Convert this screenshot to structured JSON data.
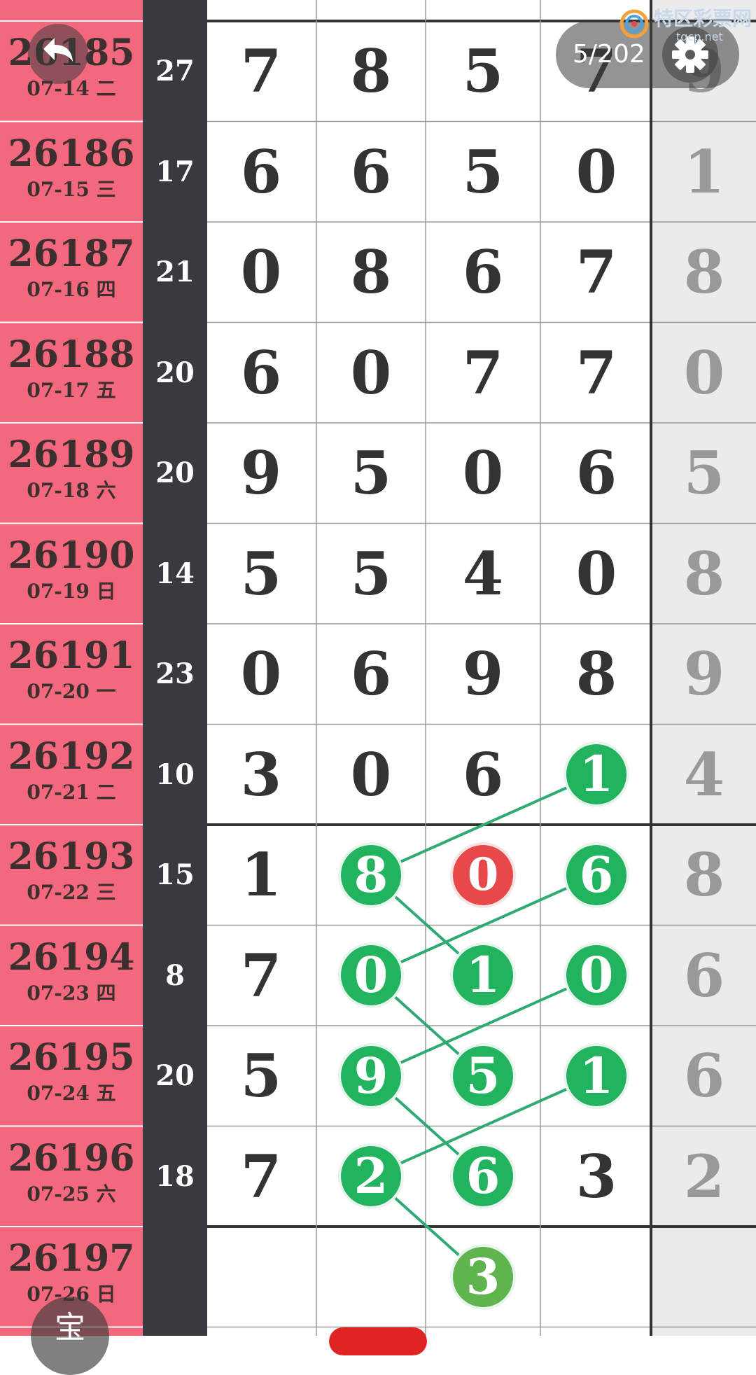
{
  "header": {
    "back_icon": "back-arrow-icon",
    "page_indicator": "5/202",
    "settings_icon": "gear-icon",
    "brand_name": "特区彩票网",
    "brand_url": "tqcp.net"
  },
  "rows": [
    {
      "issue": "26185",
      "date": "07-14 二",
      "sum": "27",
      "d": [
        "7",
        "8",
        "5",
        "7"
      ],
      "last": "9"
    },
    {
      "issue": "26186",
      "date": "07-15 三",
      "sum": "17",
      "d": [
        "6",
        "6",
        "5",
        "0"
      ],
      "last": "1"
    },
    {
      "issue": "26187",
      "date": "07-16 四",
      "sum": "21",
      "d": [
        "0",
        "8",
        "6",
        "7"
      ],
      "last": "8"
    },
    {
      "issue": "26188",
      "date": "07-17 五",
      "sum": "20",
      "d": [
        "6",
        "0",
        "7",
        "7"
      ],
      "last": "0"
    },
    {
      "issue": "26189",
      "date": "07-18 六",
      "sum": "20",
      "d": [
        "9",
        "5",
        "0",
        "6"
      ],
      "last": "5"
    },
    {
      "issue": "26190",
      "date": "07-19 日",
      "sum": "14",
      "d": [
        "5",
        "5",
        "4",
        "0"
      ],
      "last": "8"
    },
    {
      "issue": "26191",
      "date": "07-20 一",
      "sum": "23",
      "d": [
        "0",
        "6",
        "9",
        "8"
      ],
      "last": "9"
    },
    {
      "issue": "26192",
      "date": "07-21 二",
      "sum": "10",
      "d": [
        "3",
        "0",
        "6",
        "1"
      ],
      "last": "4"
    },
    {
      "issue": "26193",
      "date": "07-22 三",
      "sum": "15",
      "d": [
        "1",
        "8",
        "0",
        "6"
      ],
      "last": "8"
    },
    {
      "issue": "26194",
      "date": "07-23 四",
      "sum": "8",
      "d": [
        "7",
        "0",
        "1",
        "0"
      ],
      "last": "6"
    },
    {
      "issue": "26195",
      "date": "07-24 五",
      "sum": "20",
      "d": [
        "5",
        "9",
        "5",
        "1"
      ],
      "last": "6"
    },
    {
      "issue": "26196",
      "date": "07-25 六",
      "sum": "18",
      "d": [
        "7",
        "2",
        "6",
        "3"
      ],
      "last": "2"
    },
    {
      "issue": "26197",
      "date": "07-26 日",
      "sum": "",
      "d": [
        "",
        "",
        "3",
        ""
      ],
      "last": ""
    }
  ],
  "balls": [
    {
      "row": 7,
      "col": 3,
      "style": "green"
    },
    {
      "row": 8,
      "col": 1,
      "style": "green"
    },
    {
      "row": 8,
      "col": 2,
      "style": "red"
    },
    {
      "row": 8,
      "col": 3,
      "style": "green"
    },
    {
      "row": 9,
      "col": 1,
      "style": "green"
    },
    {
      "row": 9,
      "col": 2,
      "style": "green"
    },
    {
      "row": 9,
      "col": 3,
      "style": "green"
    },
    {
      "row": 10,
      "col": 1,
      "style": "green"
    },
    {
      "row": 10,
      "col": 2,
      "style": "green"
    },
    {
      "row": 10,
      "col": 3,
      "style": "green"
    },
    {
      "row": 11,
      "col": 1,
      "style": "green"
    },
    {
      "row": 11,
      "col": 2,
      "style": "green"
    },
    {
      "row": 12,
      "col": 2,
      "style": "light-green"
    }
  ],
  "links": [
    [
      [
        7,
        3
      ],
      [
        8,
        1
      ]
    ],
    [
      [
        8,
        1
      ],
      [
        9,
        2
      ]
    ],
    [
      [
        8,
        3
      ],
      [
        9,
        1
      ]
    ],
    [
      [
        9,
        1
      ],
      [
        10,
        2
      ]
    ],
    [
      [
        9,
        3
      ],
      [
        10,
        1
      ]
    ],
    [
      [
        10,
        1
      ],
      [
        11,
        2
      ]
    ],
    [
      [
        10,
        3
      ],
      [
        11,
        1
      ]
    ],
    [
      [
        11,
        1
      ],
      [
        12,
        2
      ]
    ]
  ],
  "colors": {
    "issue_bg": "#f4687d",
    "sum_bg": "#393940",
    "ball_green": "#22b35e",
    "ball_red": "#e8484a",
    "last_col_bg": "#ebebeb"
  },
  "bottom": {
    "left_fab_partial": "宝"
  }
}
